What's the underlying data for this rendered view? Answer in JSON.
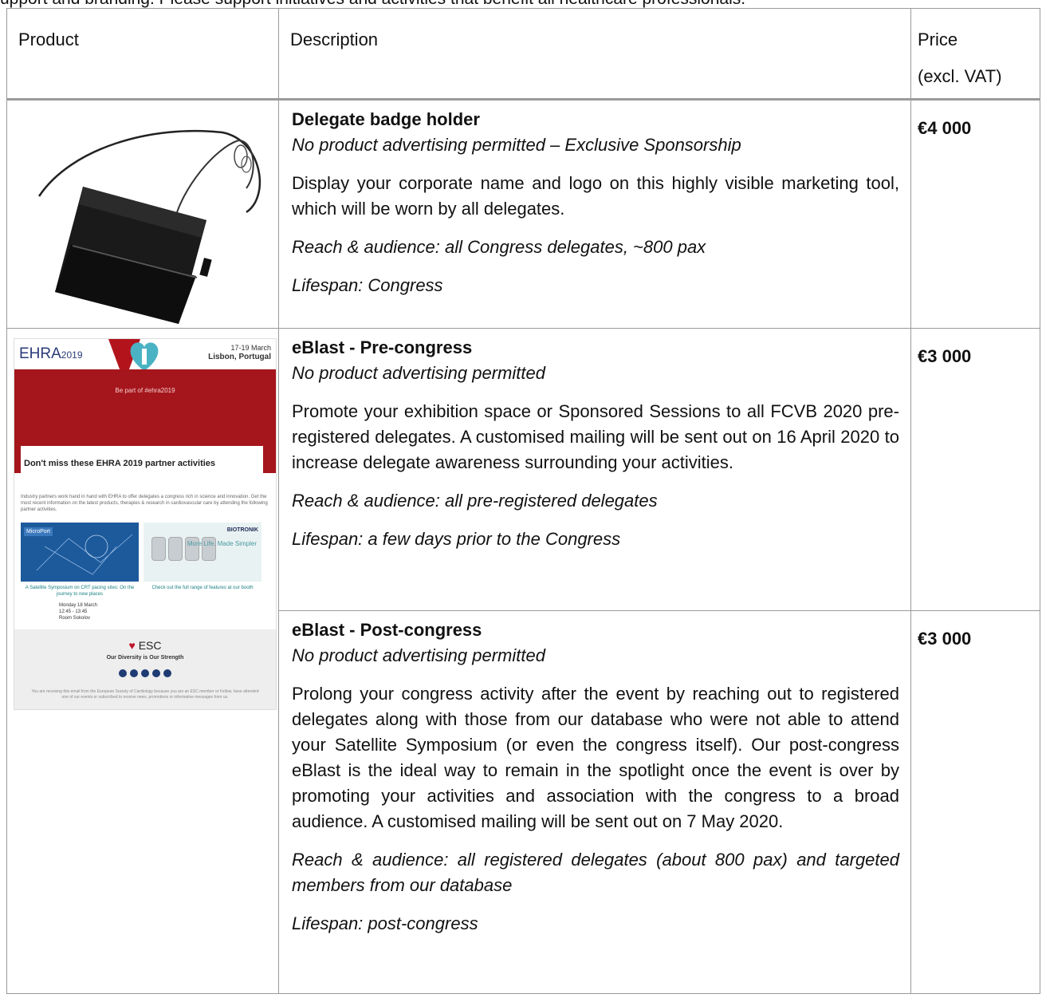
{
  "clipped_top_text": "upport and branding. Please support initiatives and activities that benefit all healthcare professionals.",
  "table": {
    "headers": {
      "product": "Product",
      "description": "Description",
      "price_line1": "Price",
      "price_line2": "(excl. VAT)"
    },
    "rows": [
      {
        "title": "Delegate badge holder",
        "subtitle": "No product advertising permitted – Exclusive Sponsorship",
        "body": "Display your corporate name and logo on this highly visible marketing tool, which will be worn by all delegates.",
        "reach": "Reach & audience: all Congress delegates, ~800 pax",
        "lifespan": "Lifespan: Congress",
        "price": "€4 000"
      },
      {
        "title": "eBlast - Pre-congress",
        "subtitle": "No product advertising permitted",
        "body": "Promote your exhibition space or Sponsored Sessions to all FCVB 2020 pre-registered delegates. A customised mailing will be sent out on 16 April 2020 to increase delegate awareness surrounding your activities.",
        "reach": "Reach & audience: all pre-registered delegates",
        "lifespan": "Lifespan: a few days prior to the Congress",
        "price": "€3 000"
      },
      {
        "title": "eBlast - Post-congress",
        "subtitle": "No product advertising permitted",
        "body": "Prolong your congress activity after the event by reaching out to registered delegates along with those from our database who were not able to attend your Satellite Symposium (or even the congress itself). Our post-congress eBlast is the ideal way to remain in the spotlight once the event is over by promoting your activities and association with the congress to a broad audience. A customised mailing will be sent out on 7 May 2020.",
        "reach": "Reach & audience: all registered delegates (about 800 pax) and targeted members from our database",
        "lifespan": "Lifespan: post-congress",
        "price": "€3 000"
      }
    ]
  },
  "eblast_mock": {
    "logo": "EHRA",
    "logo_year": "2019",
    "date": "17-19 March",
    "place": "Lisbon, Portugal",
    "tagline": "Be part of #ehra2019",
    "heading": "Don't miss these EHRA 2019 partner activities",
    "intro": "Industry partners work hand in hand with EHRA to offer delegates a congress rich in science and innovation. Get the most recent information on the latest products, therapies & research in cardiovascular care by attending the following partner activities.",
    "ad1_brand": "MicroPort",
    "ad2_brand": "BIOTRONIK",
    "ad2_line": "More Life. Made Simpler",
    "link1": "A Satellite Symposium on CRT pacing sites: On the journey to new places",
    "link2": "Check out the full range of features at our booth",
    "when_day": "Monday 18 March",
    "when_time": "12:45 - 13:45",
    "when_room": "Room Sokolov",
    "esc": "ESC",
    "diversity": "Our Diversity is Our Strength",
    "fine_print": "You are receiving this email from the European Society of Cardiology because you are an ESC member or Fellow, have attended one of our events or subscribed to receive news, promotions or informative messages from us."
  },
  "colors": {
    "border": "#9a9a9a",
    "esc_red": "#a5161c",
    "link_teal": "#1a7f83"
  }
}
